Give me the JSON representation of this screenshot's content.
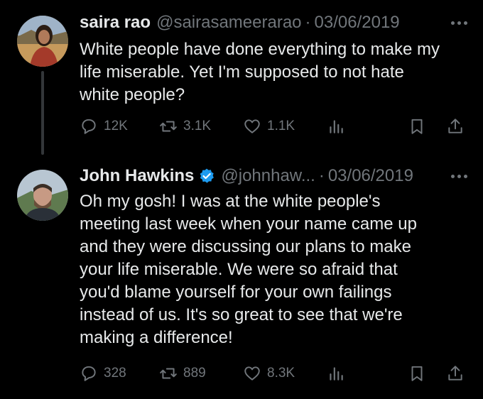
{
  "tweets": [
    {
      "name": "saira rao",
      "handle": "@sairasameerarao",
      "separator": "·",
      "date": "03/06/2019",
      "verified": false,
      "text_lines": [
        "White people have done everything to make my",
        "life miserable. Yet I'm supposed to not hate",
        "white people?"
      ],
      "replies": "12K",
      "retweets": "3.1K",
      "likes": "1.1K"
    },
    {
      "name": "John Hawkins",
      "handle": "@johnhaw...",
      "separator": "·",
      "date": "03/06/2019",
      "verified": true,
      "text_lines": [
        "Oh my gosh! I was at the white people's",
        "meeting last week when your name came up",
        "and they were discussing our plans to make",
        "your life miserable. We were so afraid that",
        "you'd blame yourself for your own failings",
        "instead of us. It's so great to see that we're",
        "making a difference!"
      ],
      "replies": "328",
      "retweets": "889",
      "likes": "8.3K"
    }
  ],
  "icons": {
    "reply": "reply-icon",
    "retweet": "retweet-icon",
    "like": "heart-icon",
    "views": "views-chart-icon",
    "bookmark": "bookmark-icon",
    "share": "share-icon",
    "more": "more-dots-icon",
    "verified": "verified-badge-icon"
  },
  "colors": {
    "verified": "#1d9bf0",
    "muted": "#71767b",
    "text": "#e7e9ea",
    "background": "#000000"
  }
}
